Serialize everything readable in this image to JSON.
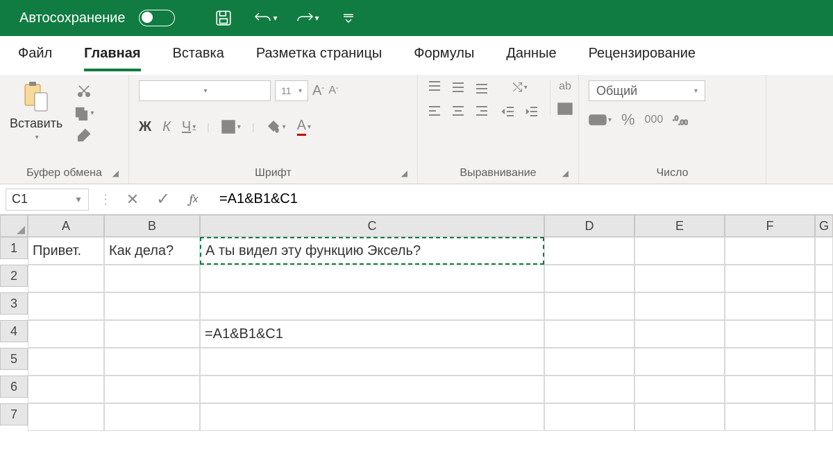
{
  "titlebar": {
    "autosave_label": "Автосохранение"
  },
  "tabs": {
    "file": "Файл",
    "home": "Главная",
    "insert": "Вставка",
    "layout": "Разметка страницы",
    "formulas": "Формулы",
    "data": "Данные",
    "review": "Рецензирование"
  },
  "ribbon": {
    "paste_label": "Вставить",
    "clipboard_group": "Буфер обмена",
    "font_group": "Шрифт",
    "align_group": "Выравнивание",
    "number_group": "Число",
    "font_size": "11",
    "wrap_label": "ab",
    "bold": "Ж",
    "italic": "К",
    "underline": "Ч",
    "number_format": "Общий",
    "currency_glyph": "%",
    "thousand_glyph": "000"
  },
  "namebox": "C1",
  "formula": "=A1&B1&C1",
  "columns": [
    "A",
    "B",
    "C",
    "D",
    "E",
    "F",
    "G"
  ],
  "rows": [
    "1",
    "2",
    "3",
    "4",
    "5",
    "6",
    "7"
  ],
  "cells": {
    "A1": "Привет.",
    "B1": "Как  дела?",
    "C1": "А ты видел эту функцию Эксель?",
    "C4": "=A1&B1&C1"
  }
}
